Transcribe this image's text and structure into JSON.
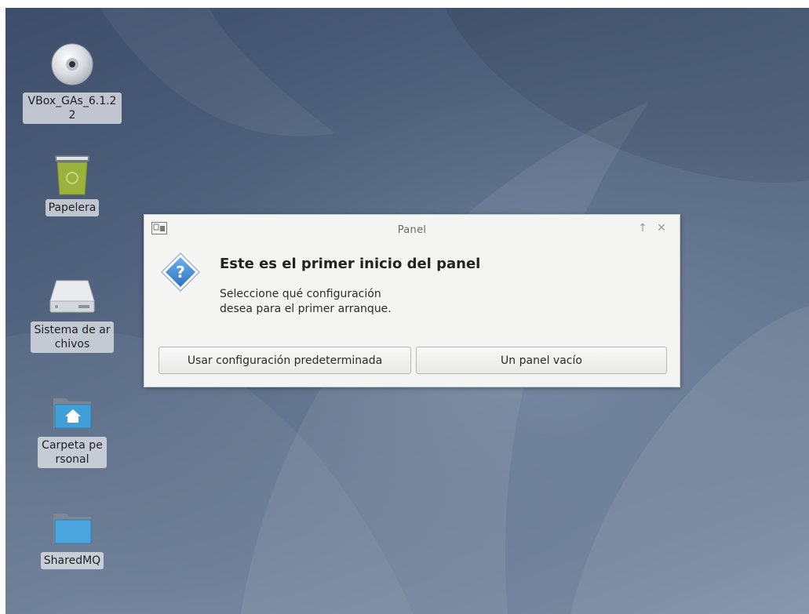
{
  "desktop": {
    "icons": [
      {
        "label": "VBox_GAs_6.1.22",
        "icon": "cd-disc-icon"
      },
      {
        "label": "Papelera",
        "icon": "trash-icon"
      },
      {
        "label": "Sistema de archivos",
        "icon": "hard-drive-icon"
      },
      {
        "label": "Carpeta personal",
        "icon": "home-folder-icon"
      },
      {
        "label": "SharedMQ",
        "icon": "folder-icon"
      }
    ]
  },
  "dialog": {
    "title": "Panel",
    "heading": "Este es el primer inicio del panel",
    "description_line1": "Seleccione qué configuración",
    "description_line2": "desea para el primer arranque.",
    "buttons": {
      "default_config": "Usar configuración predeterminada",
      "empty_panel": "Un panel vacío"
    },
    "titlebar_icons": {
      "keep_above": "↑",
      "close": "✕"
    },
    "icon": "question-icon"
  }
}
